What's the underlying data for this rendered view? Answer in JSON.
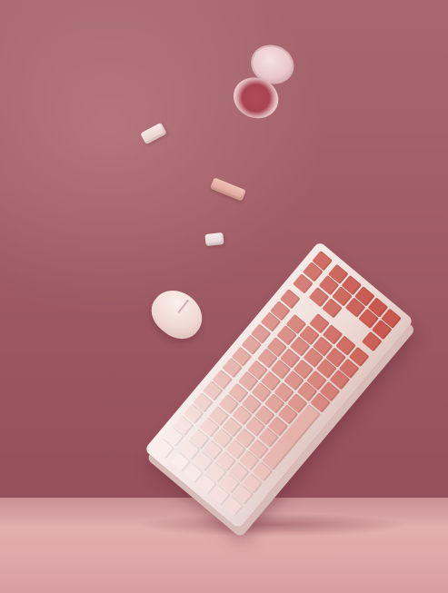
{
  "scene": {
    "objects": [
      "keyboard",
      "mouse",
      "blush-compact",
      "floating-keycaps"
    ],
    "colors": {
      "background": "#a35f67",
      "floor": "#e2adad",
      "case": "#f3e4e0",
      "key_light": "#f7e9e4",
      "key_dark": "#c9584f",
      "blush": "#a84354"
    }
  }
}
